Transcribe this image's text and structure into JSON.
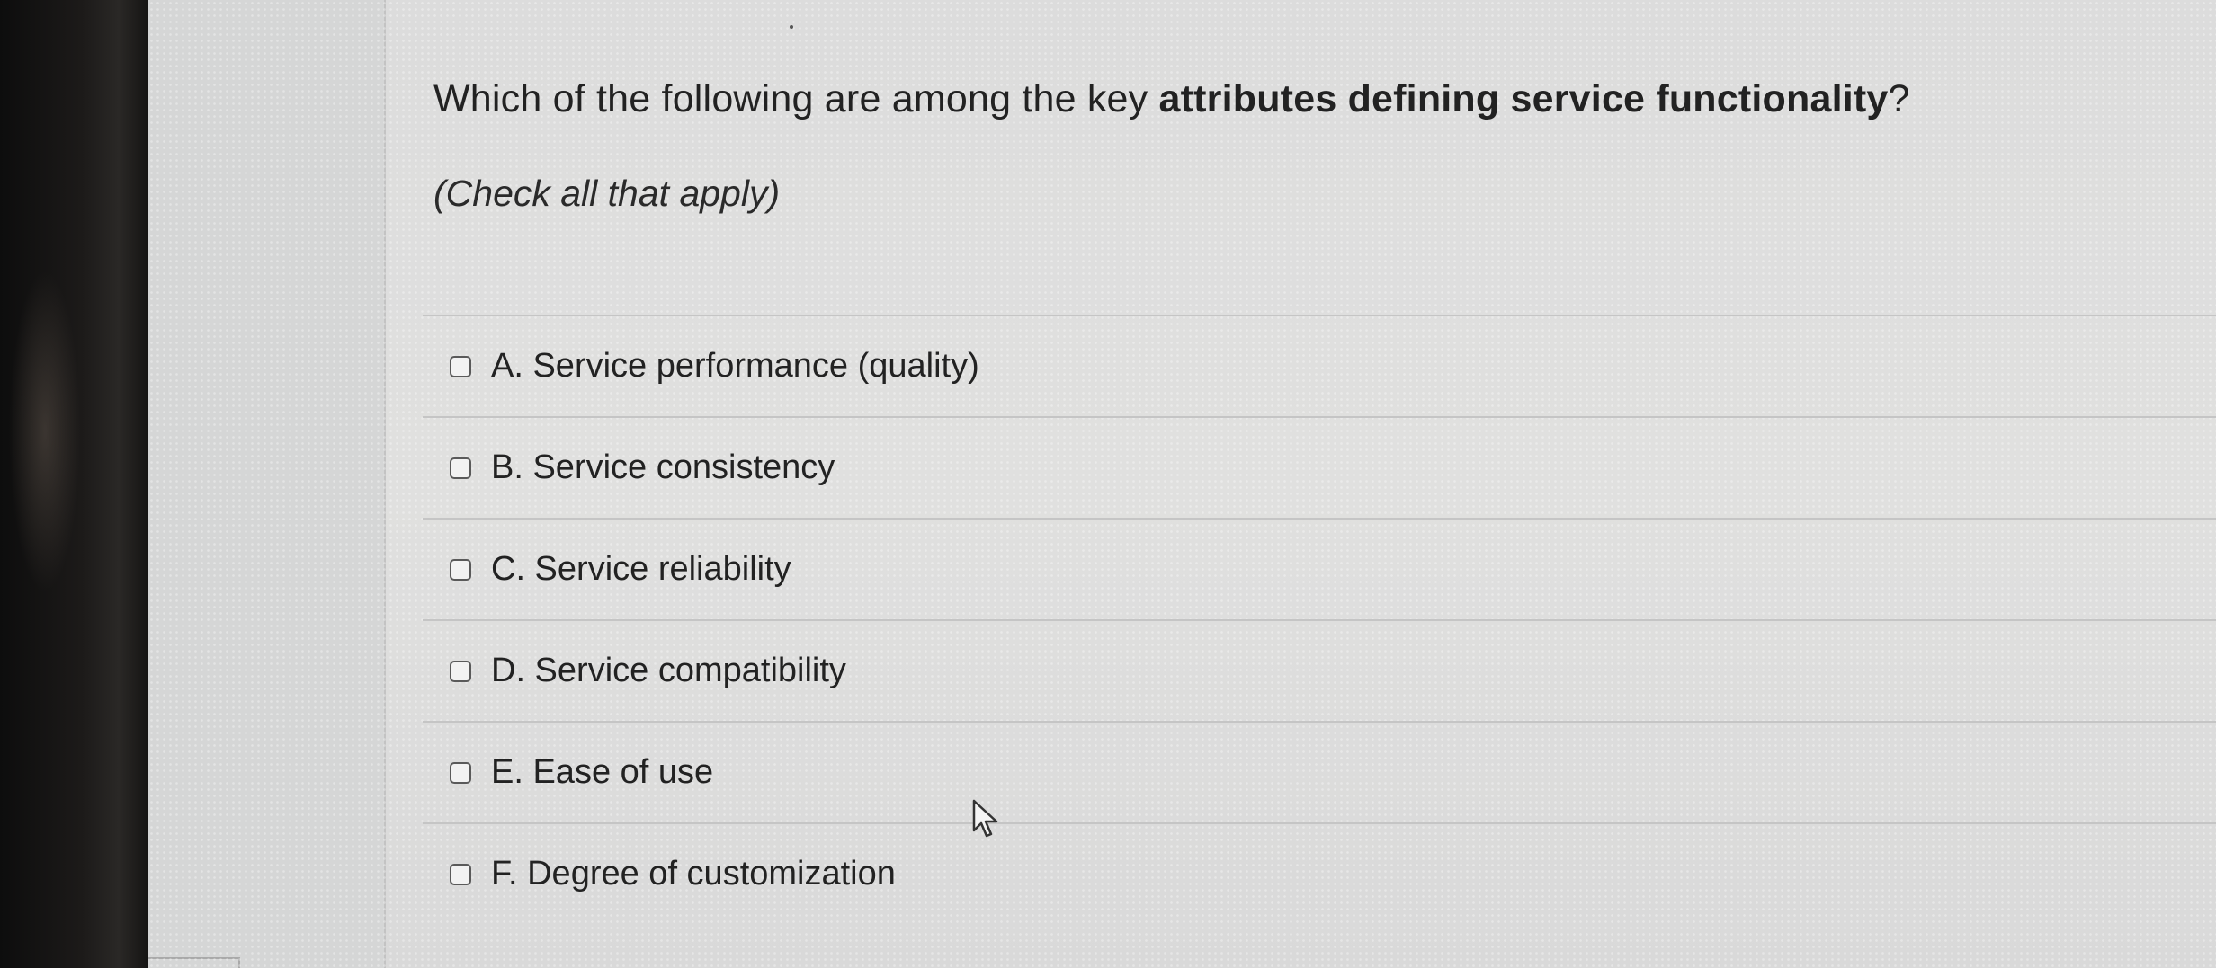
{
  "question": {
    "text_prefix": "Which of the following are among the key ",
    "text_bold": "attributes defining service functionality",
    "text_suffix": "?",
    "instruction": "(Check all that apply)"
  },
  "options": [
    {
      "label": "A. Service performance (quality)",
      "checked": false
    },
    {
      "label": "B. Service consistency",
      "checked": false
    },
    {
      "label": "C. Service reliability",
      "checked": false
    },
    {
      "label": "D. Service compatibility",
      "checked": false
    },
    {
      "label": "E. Ease of use",
      "checked": false
    },
    {
      "label": "F. Degree of customization",
      "checked": false
    }
  ],
  "colors": {
    "text": "#222222",
    "divider": "#c5c5c5",
    "checkbox_border": "#5a5a5a",
    "bezel": "#1c1a19"
  },
  "icons": {
    "cursor": "pointer-arrow-icon",
    "checkbox": "checkbox-icon"
  }
}
